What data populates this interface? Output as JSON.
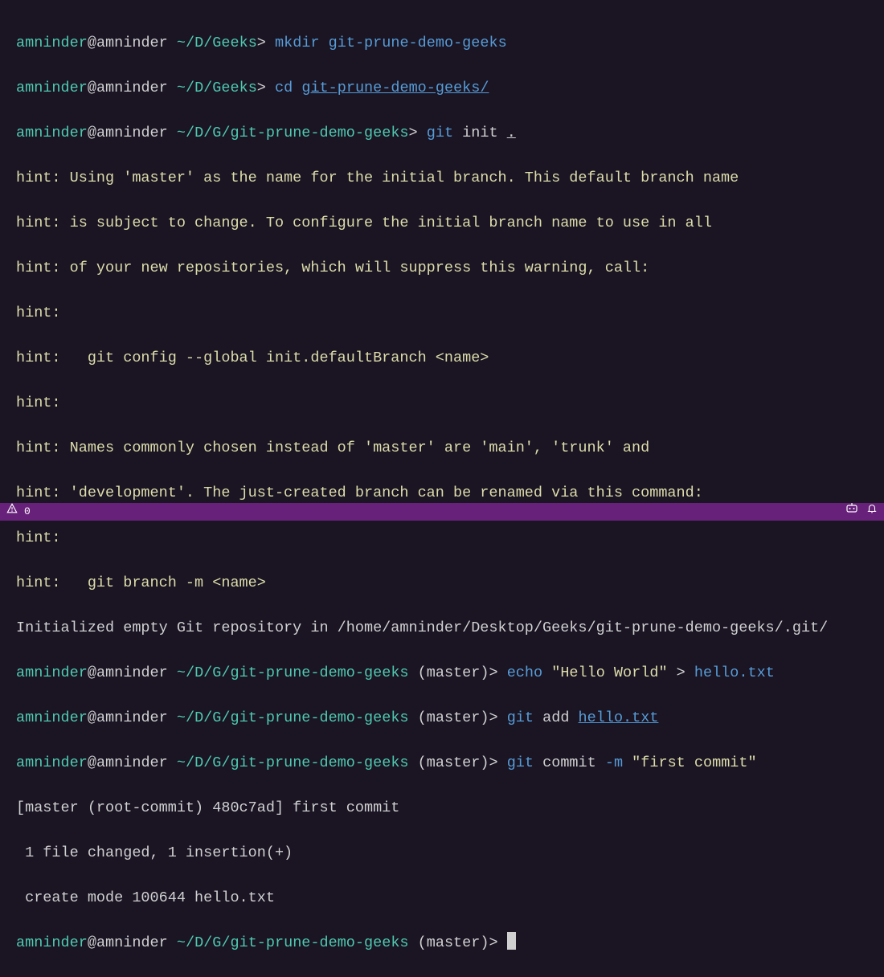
{
  "prompt": {
    "user": "amninder",
    "at": "@",
    "host": "amninder",
    "path1": "~/D/Geeks",
    "path2": "~/D/G/git-prune-demo-geeks",
    "branch": "(master)",
    "gt": ">"
  },
  "lines": {
    "l1_cmd": "mkdir",
    "l1_arg": "git-prune-demo-geeks",
    "l2_cmd": "cd",
    "l2_arg": "git-prune-demo-geeks/",
    "l3_cmd": "git",
    "l3_sub": "init",
    "l3_arg": ".",
    "h1": "hint: Using 'master' as the name for the initial branch. This default branch name",
    "h2": "hint: is subject to change. To configure the initial branch name to use in all",
    "h3": "hint: of your new repositories, which will suppress this warning, call:",
    "h4": "hint:",
    "h5": "hint:   git config --global init.defaultBranch <name>",
    "h6": "hint:",
    "h7": "hint: Names commonly chosen instead of 'master' are 'main', 'trunk' and",
    "h8": "hint: 'development'. The just-created branch can be renamed via this command:",
    "h9": "hint:",
    "h10": "hint:   git branch -m <name>",
    "init_out": "Initialized empty Git repository in /home/amninder/Desktop/Geeks/git-prune-demo-geeks/.git/",
    "l4_cmd": "echo",
    "l4_str": "\"Hello World\"",
    "l4_op": ">",
    "l4_file": "hello.txt",
    "l5_cmd": "git",
    "l5_sub": "add",
    "l5_arg": "hello.txt",
    "l6_cmd": "git",
    "l6_sub": "commit",
    "l6_flag": "-m",
    "l6_msg": "\"first commit\"",
    "c1": "[master (root-commit) 480c7ad] first commit",
    "c2": " 1 file changed, 1 insertion(+)",
    "c3": " create mode 100644 hello.txt"
  },
  "statusbar": {
    "count": "0",
    "copilot": "⊞",
    "bell": "🔔"
  }
}
